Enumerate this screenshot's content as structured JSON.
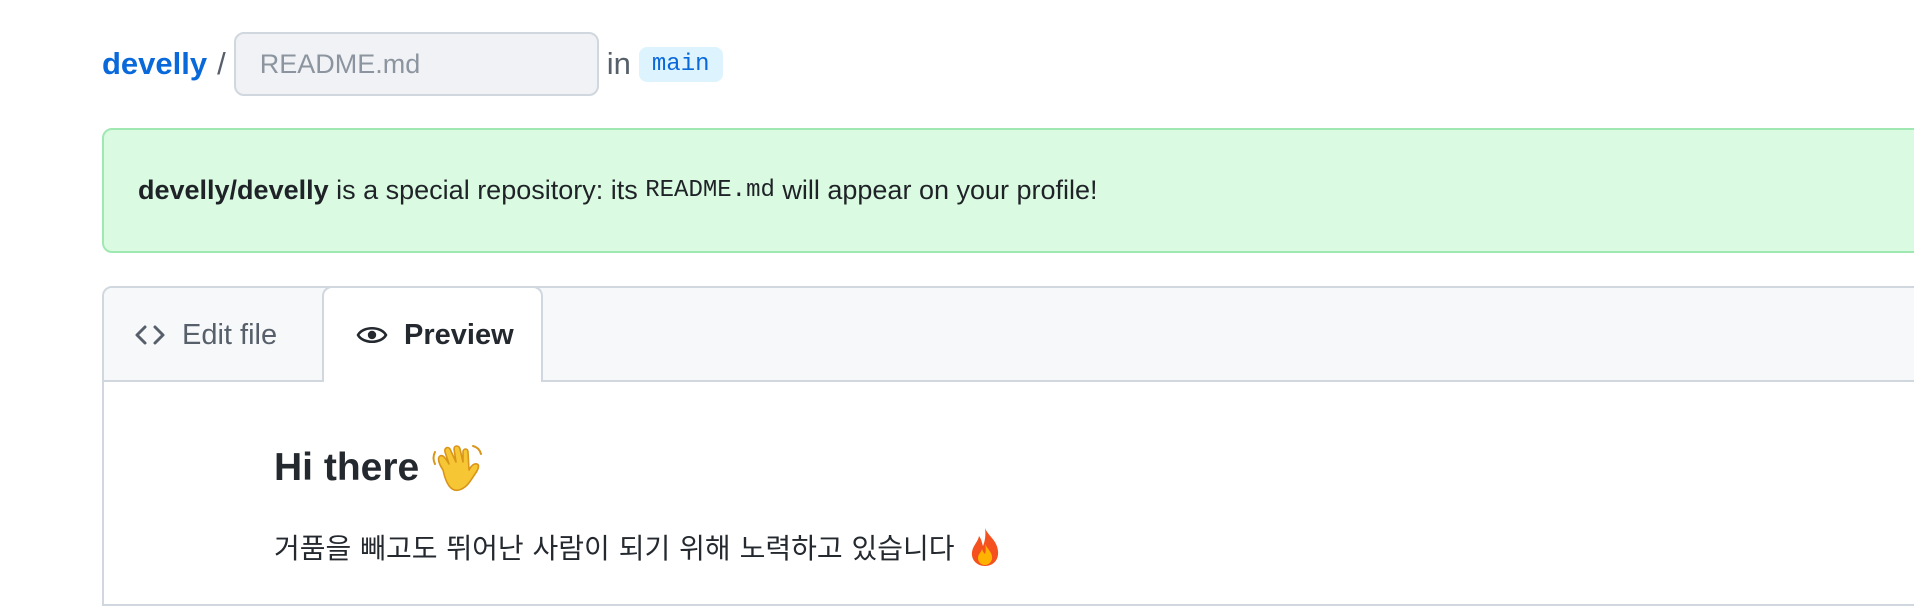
{
  "breadcrumb": {
    "owner": "develly",
    "separator": "/",
    "filename_value": "",
    "filename_placeholder": "README.md",
    "in_label": "in",
    "branch": "main"
  },
  "flash": {
    "repo": "develly/develly",
    "text_before": " is a special repository: its ",
    "code": "README.md",
    "text_after": " will appear on your profile!"
  },
  "tabs": {
    "edit_label": "Edit file",
    "preview_label": "Preview",
    "active": "Preview"
  },
  "preview": {
    "title": "Hi there",
    "title_emoji": "waving-hand-icon",
    "text": "거품을 빼고도 뛰어난 사람이 되기 위해 노력하고 있습니다",
    "text_emoji": "fire-icon"
  },
  "colors": {
    "link": "#0969da",
    "flash_bg": "#dafbe1",
    "flash_border": "#a0e8b2",
    "border": "#d0d7de",
    "tabbar_bg": "#f6f8fa"
  }
}
